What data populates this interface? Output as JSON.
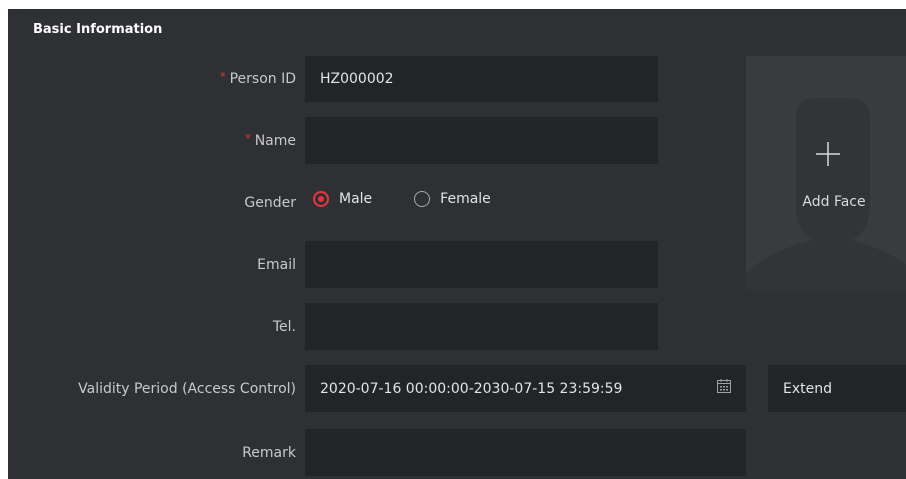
{
  "section": {
    "title": "Basic Information"
  },
  "fields": {
    "person_id": {
      "label": "Person ID",
      "required_mark": "*",
      "value": "HZ000002"
    },
    "name": {
      "label": "Name",
      "required_mark": "*",
      "value": ""
    },
    "gender": {
      "label": "Gender",
      "options": [
        "Male",
        "Female"
      ],
      "selected": "Male"
    },
    "email": {
      "label": "Email",
      "value": ""
    },
    "tel": {
      "label": "Tel.",
      "value": ""
    },
    "validity": {
      "label": "Validity Period (Access Control)",
      "value": "2020-07-16 00:00:00-2030-07-15 23:59:59",
      "extend_label": "Extend"
    },
    "remark": {
      "label": "Remark",
      "value": ""
    }
  },
  "face": {
    "add_label": "Add Face"
  },
  "icons": {
    "calendar": "calendar-icon",
    "plus": "plus-icon"
  },
  "colors": {
    "panel_bg": "#2f3034",
    "field_bg": "#232428",
    "accent": "#e8363f",
    "text": "#d2d3d6"
  }
}
